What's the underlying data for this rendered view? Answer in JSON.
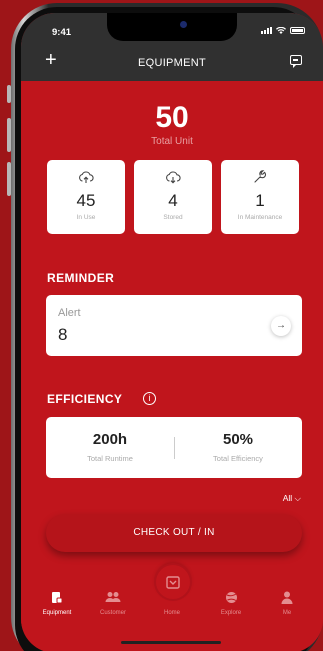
{
  "status_bar": {
    "time": "9:41"
  },
  "header": {
    "title": "EQUIPMENT"
  },
  "summary": {
    "total_value": "50",
    "total_label": "Total Unit"
  },
  "stats": [
    {
      "value": "45",
      "label": "In Use",
      "icon": "cloud-upload-icon"
    },
    {
      "value": "4",
      "label": "Stored",
      "icon": "cloud-download-icon"
    },
    {
      "value": "1",
      "label": "In Maintenance",
      "icon": "wrench-icon"
    }
  ],
  "reminder": {
    "heading": "REMINDER",
    "alert_label": "Alert",
    "alert_value": "8"
  },
  "efficiency": {
    "heading": "EFFICIENCY",
    "runtime_value": "200h",
    "runtime_label": "Total Runtime",
    "efficiency_value": "50%",
    "efficiency_label": "Total Efficiency",
    "filter_label": "All"
  },
  "checkout": {
    "label": "CHECK OUT / IN"
  },
  "tabs": [
    {
      "label": "Equipment",
      "active": true
    },
    {
      "label": "Customer",
      "active": false
    },
    {
      "label": "Home",
      "active": false
    },
    {
      "label": "Explore",
      "active": false
    },
    {
      "label": "Me",
      "active": false
    }
  ],
  "colors": {
    "primary": "#c0151c",
    "header": "#303030",
    "card": "#ffffff"
  }
}
